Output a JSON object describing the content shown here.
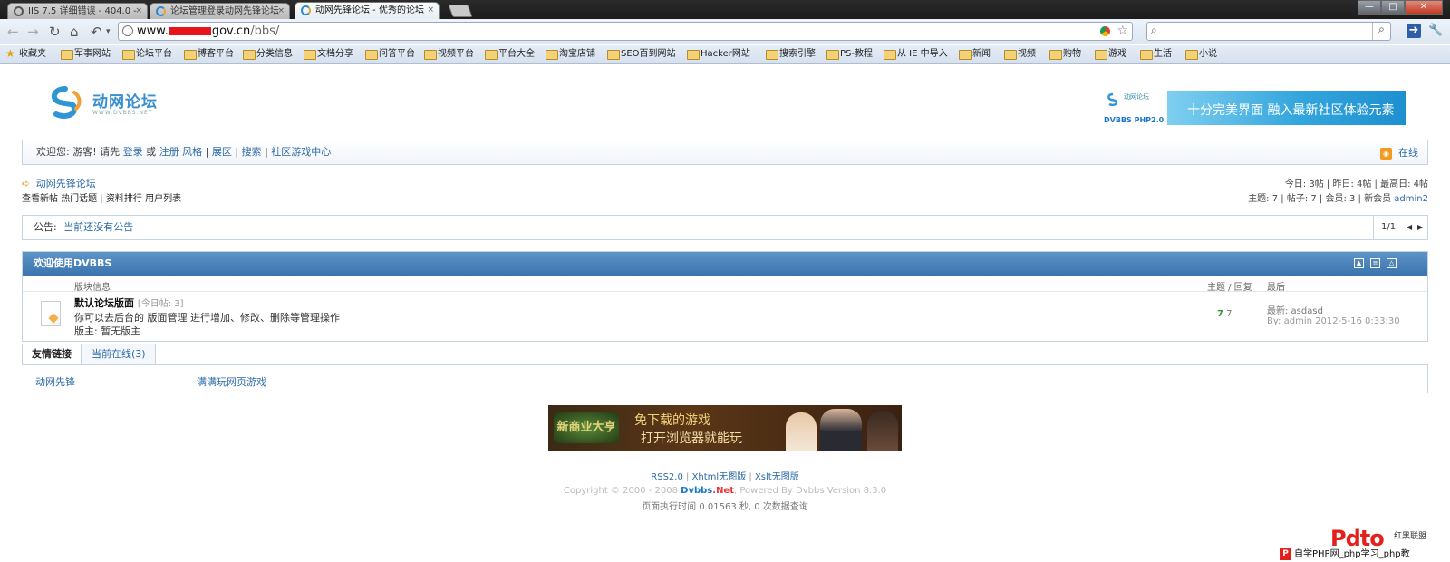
{
  "browser": {
    "tabs": [
      {
        "title": "IIS 7.5 详细错误 - 404.0 -"
      },
      {
        "title": "论坛管理登录动网先锋论坛"
      },
      {
        "title": "动网先锋论坛 - 优秀的论坛"
      }
    ],
    "close_glyph": "×",
    "url_prefix": "www.",
    "url_domain": "gov.cn",
    "url_path": "/bbs/",
    "window_buttons": [
      "—",
      "□",
      "✕"
    ],
    "bookmarks": [
      "收藏夹",
      "军事网站",
      "论坛平台",
      "博客平台",
      "分类信息",
      "文档分享",
      "问答平台",
      "视频平台",
      "平台大全",
      "淘宝店铺",
      "SEO百到网站",
      "Hacker网站",
      "搜索引擎",
      "PS-教程",
      "从 IE 中导入",
      "新闻",
      "视频",
      "购物",
      "游戏",
      "生活",
      "小说"
    ]
  },
  "site": {
    "logo_name": "动网论坛",
    "logo_sub": "WWW.DVBBS.NET",
    "banner_logo_text": "动网论坛",
    "banner_product": "DVBBS PHP2.0",
    "banner_slogan": "十分完美界面 融入最新社区体验元素"
  },
  "welcome": {
    "prefix": "欢迎您: 游客!",
    "please": "请先",
    "login": "登录",
    "or": "或",
    "register": "注册",
    "help": "风格",
    "sep": "|",
    "gallery": "展区",
    "search": "搜索",
    "game_center": "社区游戏中心",
    "rss_label": "在线"
  },
  "crumb": {
    "forum_name": "动网先锋论坛",
    "links": [
      "查看新帖",
      "热门话题",
      "资料排行",
      "用户列表"
    ]
  },
  "stats": {
    "line1": "今日: 3帖 | 昨日: 4帖 | 最高日: 4帖",
    "line2_prefix": "主题: 7 | 帖子: 7 | 会员: 3 | 新会员",
    "new_member": "admin2"
  },
  "notice": {
    "label": "公告:",
    "text": "当前还没有公告",
    "page": "1/1"
  },
  "forum": {
    "title": "欢迎使用DVBBS",
    "col_info": "版块信息",
    "col_counts": "主题 / 回复",
    "col_last": "最后",
    "name": "默认论坛版面",
    "today": "[今日帖: 3]",
    "desc": "你可以去后台的 版面管理 进行增加、修改、删除等管理操作",
    "moderator": "版主: 暂无版主",
    "topics": "7",
    "replies": "7",
    "last_post": "最新: asdasd",
    "last_by": "By: admin 2012-5-16 0:33:30"
  },
  "tabs": {
    "links_tab": "友情链接",
    "online_tab": "当前在线(3)",
    "link1": "动网先锋",
    "link2": "满满玩网页游戏"
  },
  "ad": {
    "game_logo": "新商业大亨",
    "line1": "免下载的游戏",
    "line2": "打开浏览器就能玩"
  },
  "footer": {
    "rss": "RSS2.0",
    "xhtml": "Xhtml无图版",
    "xslt": "Xslt无图版",
    "copyright": "Copyright © 2000 - 2008",
    "brand": "Dvbbs",
    "brand_net": ".Net",
    "powered": ", Powered By Dvbbs Version 8.3.0",
    "exec_time": "页面执行时间 0.01563 秒, 0 次数据查询"
  },
  "watermark": {
    "big": "Pdto",
    "small": "红黑联盟",
    "strip": "自学PHP网_php学习_php教"
  },
  "colors": {
    "header_blue": "#3b74ae",
    "link_blue": "#2c6aa6",
    "rss_orange": "#f39a21",
    "redact_red": "#e8141c"
  }
}
